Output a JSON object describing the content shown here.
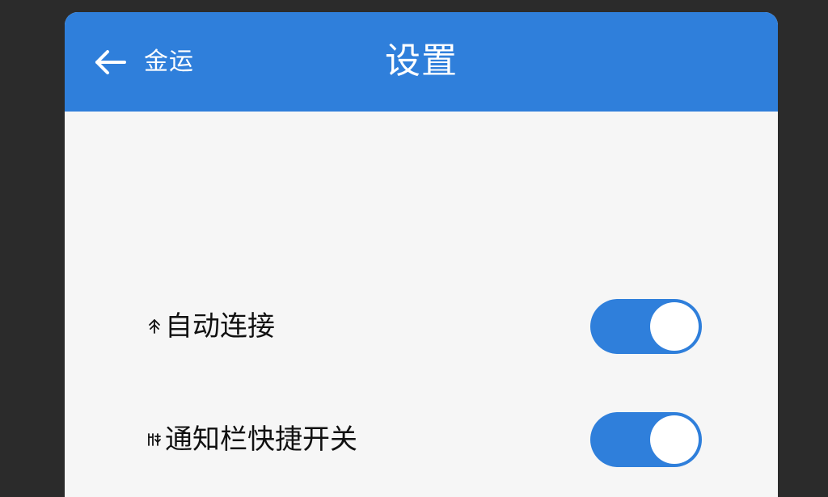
{
  "header": {
    "back_label": "金运",
    "title": "设置"
  },
  "settings": {
    "items": [
      {
        "label": "自动连接",
        "enabled": true
      },
      {
        "label": "通知栏快捷开关",
        "enabled": true
      }
    ]
  },
  "colors": {
    "background": "#2b2b2b",
    "header": "#2f7fdb",
    "surface": "#f6f6f6",
    "toggle_on": "#2f7fdb",
    "text": "#111111",
    "white": "#ffffff"
  },
  "icons": {
    "back": "arrow-left-icon",
    "auto_connect": "auto-connect-icon",
    "quick_toggle": "quick-toggle-icon"
  }
}
